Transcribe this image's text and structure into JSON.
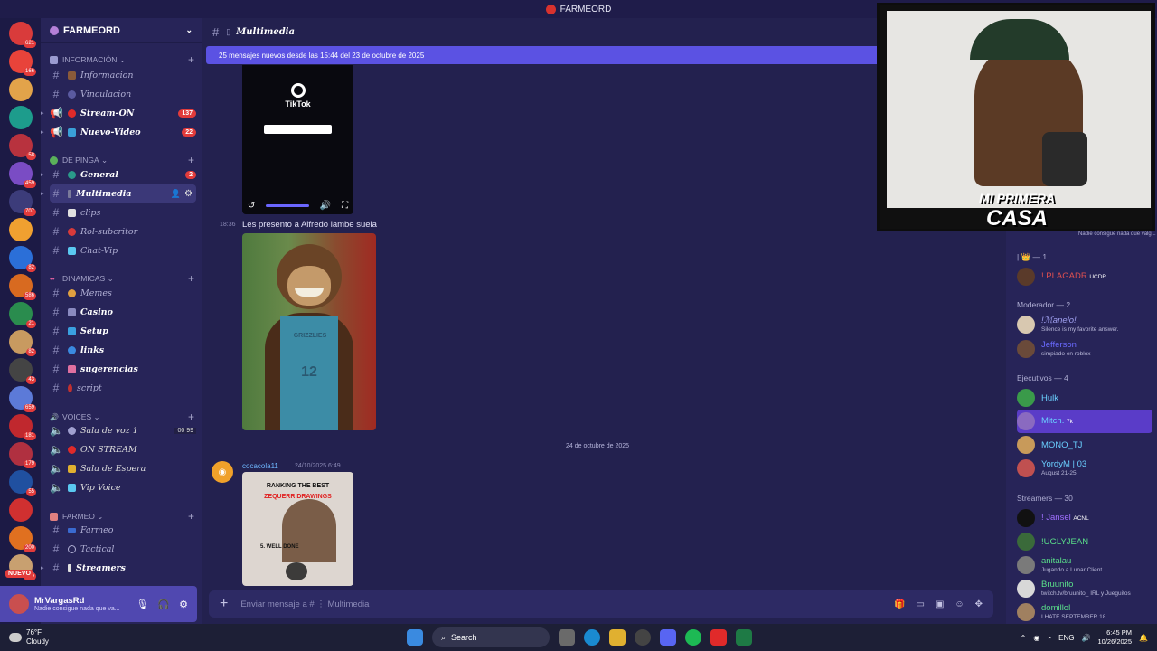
{
  "window": {
    "title": "FARMEORD"
  },
  "guild": {
    "name": "FARMEORD"
  },
  "servers": [
    {
      "badge": "621",
      "color": "#d93b3b"
    },
    {
      "badge": "166",
      "color": "#e8433a"
    },
    {
      "badge": "",
      "color": "#e2a34a"
    },
    {
      "badge": "",
      "color": "#1d9c8c"
    },
    {
      "badge": "58",
      "color": "#b8323e"
    },
    {
      "badge": "459",
      "color": "#7a4cc4"
    },
    {
      "badge": "707",
      "color": "#3c3c7a"
    },
    {
      "badge": "",
      "color": "#f0a030"
    },
    {
      "badge": "82",
      "color": "#2b6fd8"
    },
    {
      "badge": "586",
      "color": "#d86a20"
    },
    {
      "badge": "21",
      "color": "#2a8c4e"
    },
    {
      "badge": "82",
      "color": "#c89a60"
    },
    {
      "badge": "43",
      "color": "#444"
    },
    {
      "badge": "659",
      "color": "#5c7ad8"
    },
    {
      "badge": "181",
      "color": "#c0282e"
    },
    {
      "badge": "179",
      "color": "#b03040"
    },
    {
      "badge": "55",
      "color": "#2050a0"
    },
    {
      "badge": "",
      "color": "#d03030"
    },
    {
      "badge": "200",
      "color": "#e07020"
    },
    {
      "badge": "195",
      "color": "#c8a070"
    }
  ],
  "servers_new_label": "NUEVO",
  "categories": {
    "info": "INFORMACIÓN",
    "pinga": "DE PINGA",
    "dinamicas": "DINAMICAS",
    "voices": "VOICES",
    "farmeo": "FARMEO"
  },
  "channels": {
    "informacion": "Informacion",
    "vinculacion": "Vinculacion",
    "stream_on": "Stream-ON",
    "stream_on_badge": "137",
    "nuevo_video": "Nuevo-Video",
    "nuevo_video_badge": "22",
    "general": "General",
    "general_badge": "2",
    "multimedia": "Multimedia",
    "clips": "clips",
    "rol": "Rol-subcritor",
    "chatvip": "Chat-Vip",
    "memes": "Memes",
    "casino": "Casino",
    "setup": "Setup",
    "links": "links",
    "sugerencias": "sugerencias",
    "script": "script",
    "sala_voz": "Sala de voz 1",
    "sala_voz_count": "00 99",
    "on_stream": "ON STREAM",
    "sala_espera": "Sala de Espera",
    "vip_voice": "Vip Voice",
    "farmeo": "Farmeo",
    "tactical": "Tactical",
    "streamers": "Streamers"
  },
  "user": {
    "name": "MrVargasRd",
    "status": "Nadie consigue nada que va..."
  },
  "chat": {
    "channel_title": "Multimedia",
    "new_messages": "25 mensajes nuevos desde las 15:44 del 23 de octubre de 2025",
    "tiktok_logo": "TikTok",
    "msg1_time": "18:36",
    "msg1_text": "Les presento a Alfredo lambe suela",
    "jersey_text": "GRIZZLIES",
    "jersey_num": "12",
    "date_divider": "24 de octubre de 2025",
    "bot_name": "cocacola11",
    "bot_time": "24/10/2025 6:49",
    "rank_title1": "RANKING THE BEST",
    "rank_title2": "ZEQUERR DRAWINGS",
    "rank_item": "5. WELL DONE",
    "composer_placeholder": "Enviar mensaje a # ⋮ Multimedia"
  },
  "webcam": {
    "logo_line1": "MI PRIMERA",
    "logo_line2": "CASA"
  },
  "members": {
    "status_top": "Nadie consigue nada que valg...",
    "group1": "| 👑 — 1",
    "m1": "! PLAGADR",
    "m1_tag": "UCDR",
    "group2": "Moderador — 2",
    "m2": "!ℳanelo!",
    "m2_status": "Silence is my favorite answer.",
    "m3": "Jefferson",
    "m3_status": "simpiado en roblox",
    "group3": "Ejecutivos — 4",
    "m4": "Hulk",
    "m5": "Mitch.",
    "m5_tag": "7k",
    "m6": "MONO_TJ",
    "m7": "YordyM | 03",
    "m7_status": "August 21-25",
    "group4": "Streamers — 30",
    "m8": "! Jansel",
    "m8_tag": "ACNL",
    "m9": "!UGLYJEAN",
    "m10": "anitalau",
    "m10_status": "Jugando a Lunar Client",
    "m11": "Bruunito",
    "m11_status": "twitch.tv/bruunito_ IRL y Jueguitos",
    "m12": "domillol",
    "m12_status": "I HATE SEPTEMBER 18"
  },
  "taskbar": {
    "temp": "76°F",
    "weather": "Cloudy",
    "search": "Search",
    "lang": "ENG",
    "time": "6:45 PM",
    "date": "10/26/2025"
  }
}
